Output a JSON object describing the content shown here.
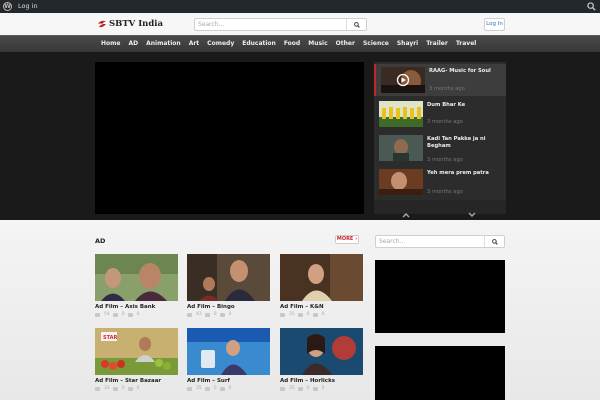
{
  "adminbar": {
    "login_label": "Log in"
  },
  "header": {
    "logo_text": "SBTV India",
    "search_placeholder": "Search...",
    "login_label": "Log In"
  },
  "nav": {
    "items": [
      "Home",
      "AD",
      "Animation",
      "Art",
      "Comedy",
      "Education",
      "Food",
      "Music",
      "Other",
      "Science",
      "Shayri",
      "Trailer",
      "Travel"
    ]
  },
  "playlist": {
    "items": [
      {
        "title": "RAAG- Music for Soul",
        "time": "3 months ago"
      },
      {
        "title": "Dum Bhar Ke",
        "time": "3 months ago"
      },
      {
        "title": "Kadi Tan Pakke ja ni Begham",
        "time": "3 months ago"
      },
      {
        "title": "Yeh mera prem patra",
        "time": "3 months ago"
      }
    ]
  },
  "section": {
    "title": "AD",
    "more_label": "MORE"
  },
  "cards": [
    {
      "title": "Ad Film – Axis Bank",
      "views": "54",
      "comments": "0",
      "likes": "0"
    },
    {
      "title": "Ad Film – Bingo",
      "views": "42",
      "comments": "0",
      "likes": "0"
    },
    {
      "title": "Ad Film – K&N",
      "views": "35",
      "comments": "0",
      "likes": "0"
    },
    {
      "title": "Ad Film – Star Bazaar",
      "views": "31",
      "comments": "0",
      "likes": "0"
    },
    {
      "title": "Ad Film – Surf",
      "views": "35",
      "comments": "0",
      "likes": "0"
    },
    {
      "title": "Ad Film – Horlicks",
      "views": "35",
      "comments": "0",
      "likes": "0"
    }
  ],
  "sidebar": {
    "search_placeholder": "Search..."
  },
  "colors": {
    "accent": "#c0262c",
    "nav_bg": "#404040",
    "featured_bg": "#1a1a1a"
  }
}
